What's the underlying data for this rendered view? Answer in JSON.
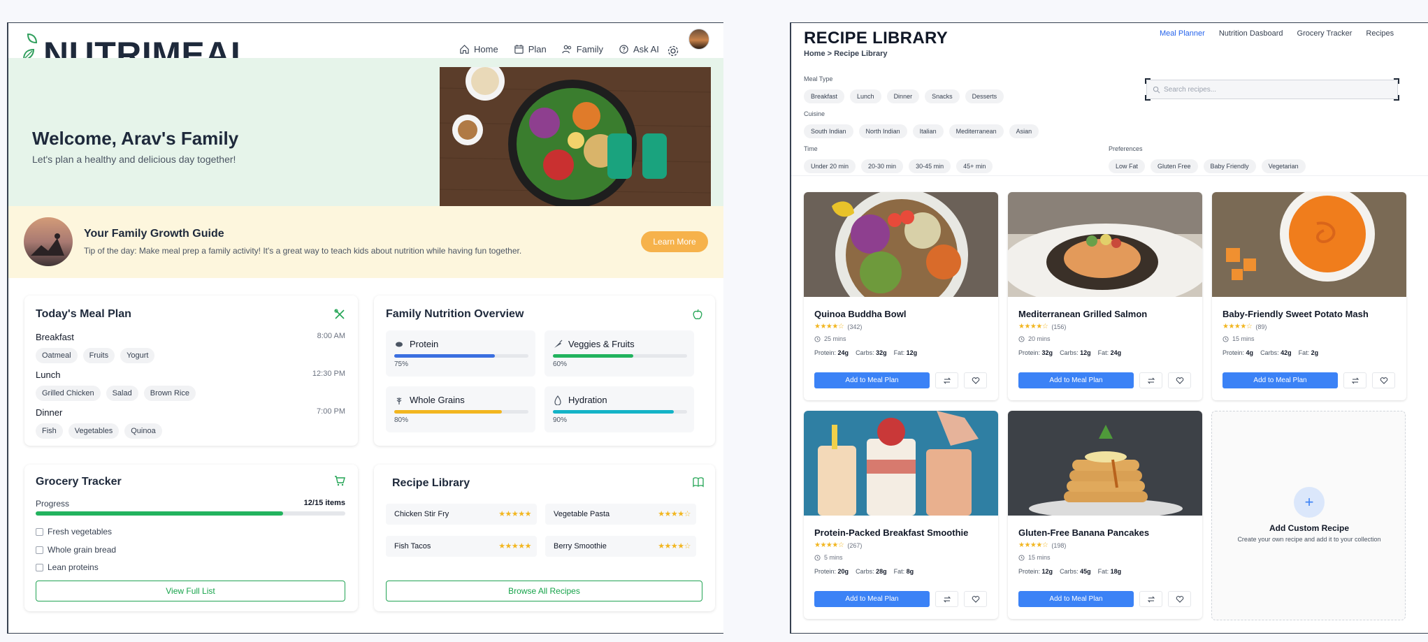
{
  "nutrimeal": {
    "brand": "NUTRIMEAL",
    "nav": [
      {
        "label": "Home",
        "icon": "home-icon"
      },
      {
        "label": "Plan",
        "icon": "calendar-icon"
      },
      {
        "label": "Family",
        "icon": "users-icon"
      },
      {
        "label": "Ask AI",
        "icon": "help-icon"
      }
    ],
    "hero": {
      "title": "Welcome, Arav's Family",
      "subtitle": "Let's plan a healthy and delicious day together!"
    },
    "guide": {
      "title": "Your Family Growth Guide",
      "tip": "Tip of the day: Make meal prep a family activity! It's a great way to teach kids about nutrition while having fun together.",
      "button": "Learn More"
    },
    "meal_plan": {
      "title": "Today's Meal Plan",
      "meals": [
        {
          "name": "Breakfast",
          "time": "8:00 AM",
          "items": [
            "Oatmeal",
            "Fruits",
            "Yogurt"
          ]
        },
        {
          "name": "Lunch",
          "time": "12:30 PM",
          "items": [
            "Grilled Chicken",
            "Salad",
            "Brown Rice"
          ]
        },
        {
          "name": "Dinner",
          "time": "7:00 PM",
          "items": [
            "Fish",
            "Vegetables",
            "Quinoa"
          ]
        }
      ]
    },
    "nutrition": {
      "title": "Family Nutrition Overview",
      "items": [
        {
          "label": "Protein",
          "pct_label": "75%",
          "value": 0.75,
          "color": "#3b6fe0"
        },
        {
          "label": "Veggies & Fruits",
          "pct_label": "60%",
          "value": 0.6,
          "color": "#22b35e"
        },
        {
          "label": "Whole Grains",
          "pct_label": "80%",
          "value": 0.8,
          "color": "#f2b620"
        },
        {
          "label": "Hydration",
          "pct_label": "90%",
          "value": 0.9,
          "color": "#14b3c7"
        }
      ]
    },
    "grocery": {
      "title": "Grocery Tracker",
      "progress_label": "Progress",
      "progress_count": "12/15 items",
      "progress_value": 0.8,
      "items": [
        "Fresh vegetables",
        "Whole grain bread",
        "Lean proteins"
      ],
      "button": "View Full List"
    },
    "recipe_library": {
      "title": "Recipe Library",
      "items": [
        {
          "name": "Chicken Stir Fry",
          "stars": "★★★★★"
        },
        {
          "name": "Vegetable Pasta",
          "stars": "★★★★☆"
        },
        {
          "name": "Fish Tacos",
          "stars": "★★★★★"
        },
        {
          "name": "Berry Smoothie",
          "stars": "★★★★☆"
        }
      ],
      "button": "Browse All Recipes"
    }
  },
  "library": {
    "title": "RECIPE LIBRARY",
    "breadcrumb": "Home > Recipe Library",
    "nav": [
      "Meal Planner",
      "Nutrition Dasboard",
      "Grocery Tracker",
      "Recipes"
    ],
    "search_placeholder": "Search recipes...",
    "filters": {
      "meal_type": {
        "label": "Meal Type",
        "options": [
          "Breakfast",
          "Lunch",
          "Dinner",
          "Snacks",
          "Desserts"
        ]
      },
      "cuisine": {
        "label": "Cuisine",
        "options": [
          "South Indian",
          "North Indian",
          "Italian",
          "Mediterranean",
          "Asian"
        ]
      },
      "time": {
        "label": "Time",
        "options": [
          "Under 20 min",
          "20-30 min",
          "30-45 min",
          "45+ min"
        ]
      },
      "preferences": {
        "label": "Preferences",
        "options": [
          "Low Fat",
          "Gluten Free",
          "Baby Friendly",
          "Vegetarian"
        ]
      }
    },
    "recipes": [
      {
        "title": "Quinoa Buddha Bowl",
        "stars": "★★★★☆",
        "count": "(342)",
        "time": "25 mins",
        "protein": "24g",
        "carbs": "32g",
        "fat": "12g",
        "button": "Add to Meal Plan"
      },
      {
        "title": "Mediterranean Grilled Salmon",
        "stars": "★★★★☆",
        "count": "(156)",
        "time": "20 mins",
        "protein": "32g",
        "carbs": "12g",
        "fat": "24g",
        "button": "Add to Meal Plan"
      },
      {
        "title": "Baby-Friendly Sweet Potato Mash",
        "stars": "★★★★☆",
        "count": "(89)",
        "time": "15 mins",
        "protein": "4g",
        "carbs": "42g",
        "fat": "2g",
        "button": "Add to Meal Plan"
      },
      {
        "title": "Protein-Packed Breakfast Smoothie",
        "stars": "★★★★☆",
        "count": "(267)",
        "time": "5 mins",
        "protein": "20g",
        "carbs": "28g",
        "fat": "8g",
        "button": "Add to Meal Plan"
      },
      {
        "title": "Gluten-Free Banana Pancakes",
        "stars": "★★★★☆",
        "count": "(198)",
        "time": "15 mins",
        "protein": "12g",
        "carbs": "45g",
        "fat": "18g",
        "button": "Add to Meal Plan"
      }
    ],
    "macro_labels": {
      "protein": "Protein:",
      "carbs": "Carbs:",
      "fat": "Fat:"
    },
    "custom": {
      "title": "Add Custom Recipe",
      "subtitle": "Create your own recipe and add it to your collection",
      "plus": "+"
    }
  }
}
